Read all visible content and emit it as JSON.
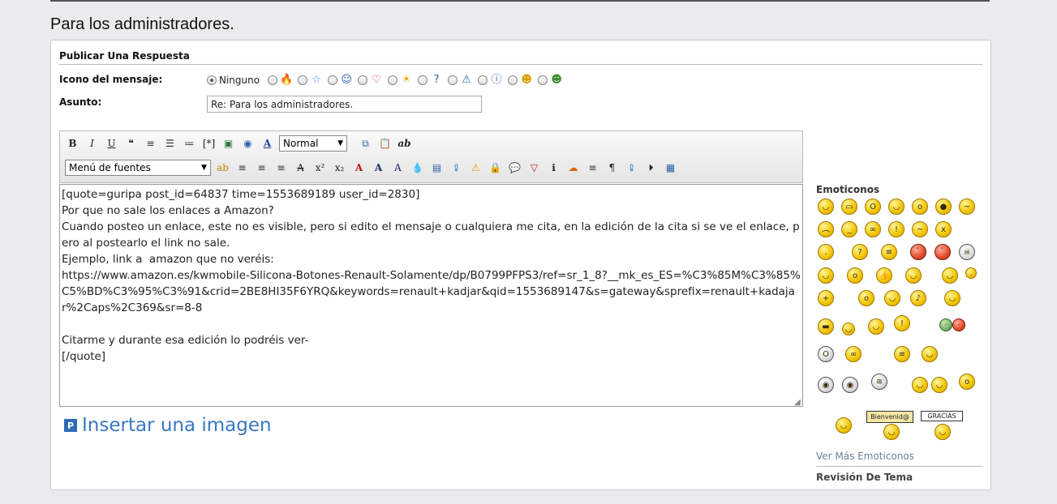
{
  "page": {
    "title": "Para los administradores."
  },
  "reply": {
    "section_title": "Publicar Una Respuesta",
    "icon_label": "Icono del mensaje:",
    "icon_none_label": "Ninguno",
    "icon_options": [
      "none",
      "fire-icon",
      "star-icon",
      "face-icon",
      "heart-icon",
      "sun-icon",
      "question-icon",
      "warning-icon",
      "info-icon",
      "wink-icon",
      "grin-icon"
    ],
    "subject_label": "Asunto:",
    "subject_value": "Re: Para los administradores."
  },
  "toolbar": {
    "bold": "B",
    "italic": "I",
    "underline": "U",
    "size_select": "Normal",
    "font_menu": "Menú de fuentes",
    "spell": "ab"
  },
  "editor": {
    "text": "[quote=guripa post_id=64837 time=1553689189 user_id=2830]\nPor que no sale los enlaces a Amazon?\nCuando posteo un enlace, este no es visible, pero si edito el mensaje o cualquiera me cita, en la edición de la cita si se ve el enlace, pero al postearlo el link no sale.\nEjemplo, link a  amazon que no veréis:\nhttps://www.amazon.es/kwmobile-Silicona-Botones-Renault-Solamente/dp/B0799PFPS3/ref=sr_1_8?__mk_es_ES=%C3%85M%C3%85%C5%BD%C3%95%C3%91&crid=2BE8HI35F6YRQ&keywords=renault+kadjar&qid=1553689147&s=gateway&sprefix=renault+kadajar%2Caps%2C369&sr=8-8\n\nCitarme y durante esa edición lo podréis ver-\n[/quote]"
  },
  "insert_image": {
    "label": "Insertar una imagen"
  },
  "emoticons": {
    "title": "Emoticonos",
    "more": "Ver Más Emoticonos",
    "sign_welcome": "Bienvenid@",
    "sign_thanks": "GRACIAS"
  },
  "review": {
    "label": "Revisión De Tema"
  }
}
